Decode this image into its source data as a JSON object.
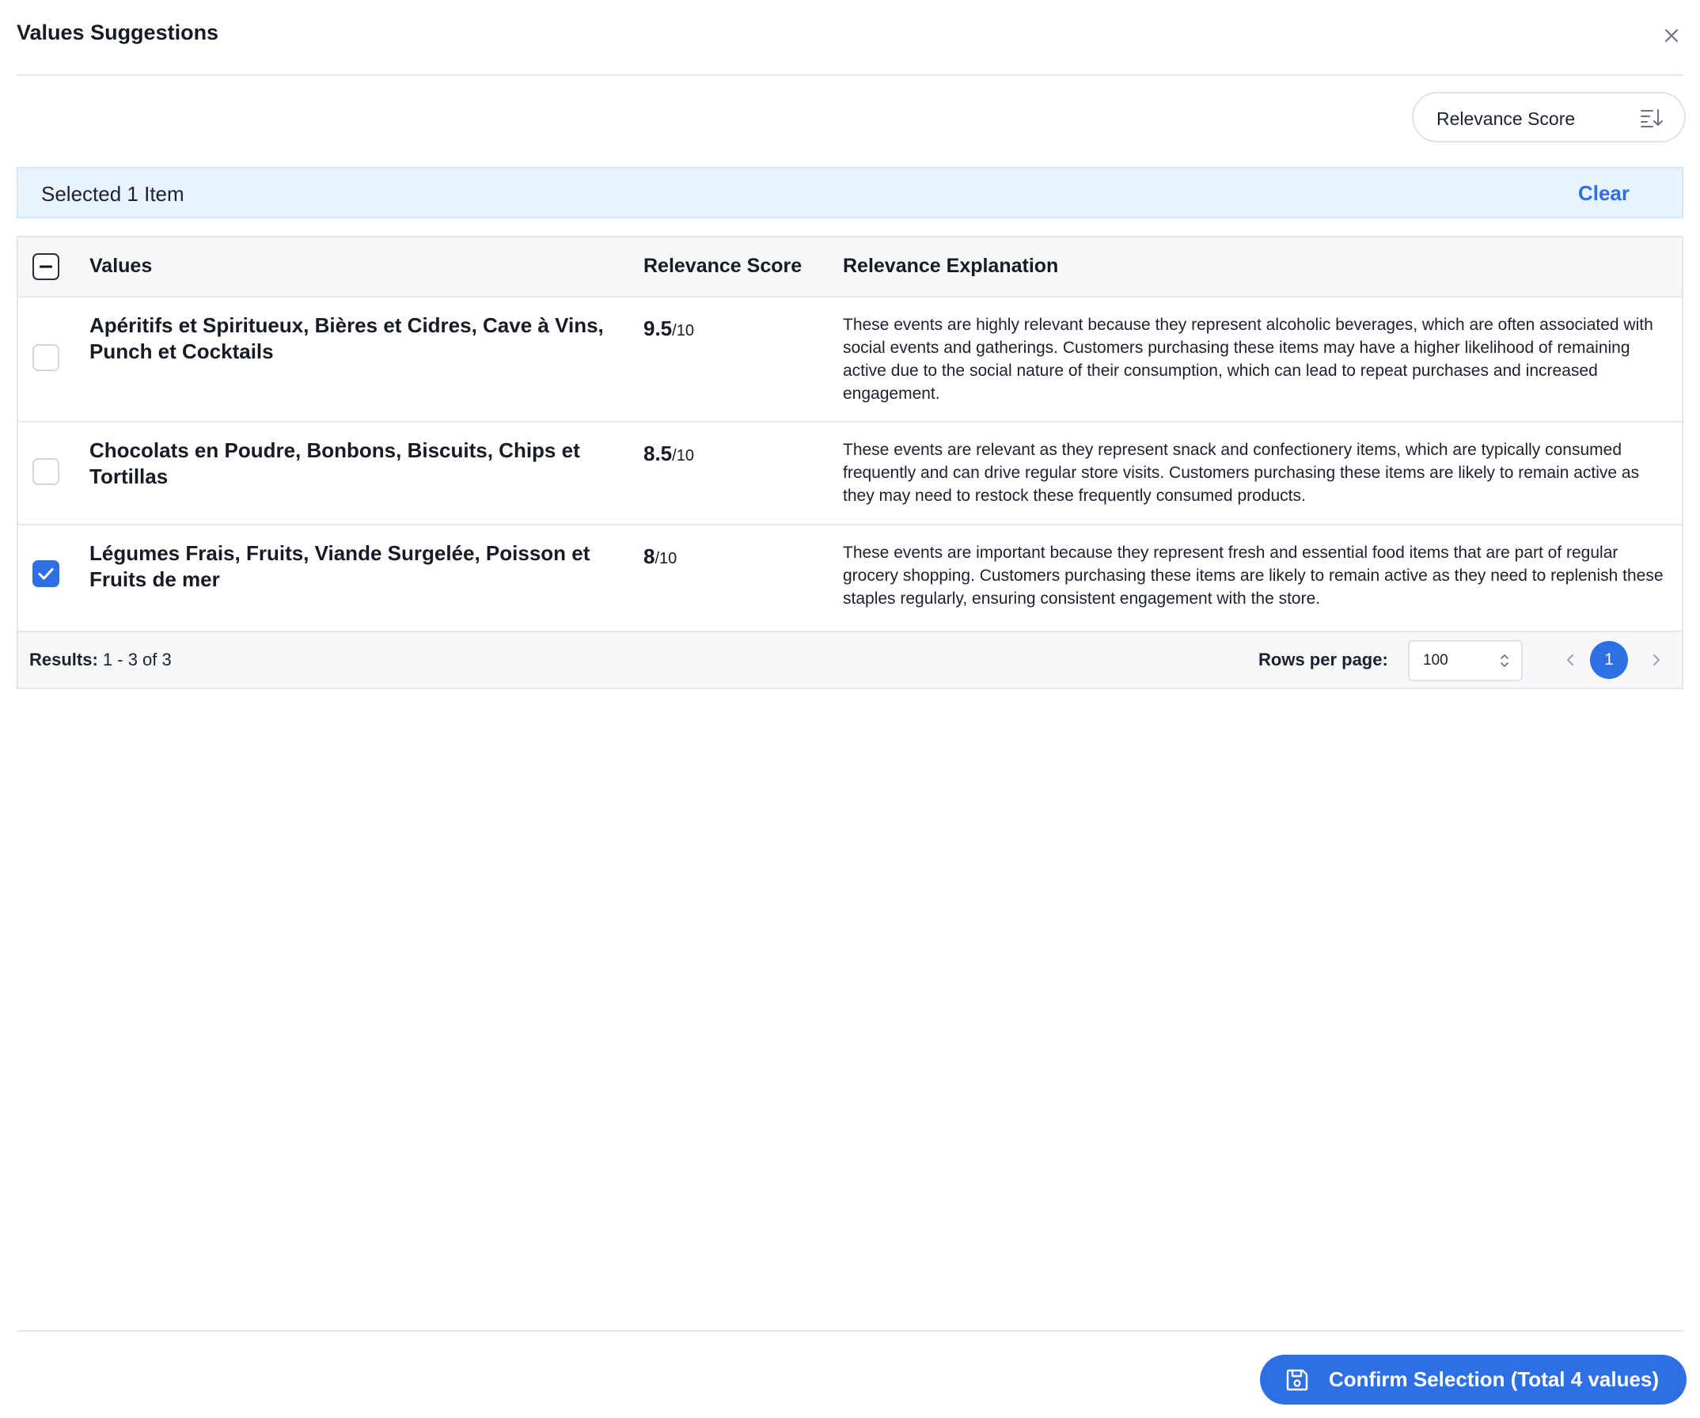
{
  "dialog": {
    "title": "Values Suggestions"
  },
  "icons": {
    "close": "close-icon",
    "sort": "sort-descending-icon",
    "save": "save-icon",
    "chevron_left": "chevron-left-icon",
    "chevron_right": "chevron-right-icon",
    "check": "check-icon",
    "indeterminate": "minus-icon"
  },
  "sort": {
    "label": "Relevance Score"
  },
  "selection": {
    "text": "Selected 1 Item",
    "clear_label": "Clear"
  },
  "table": {
    "headers": {
      "values": "Values",
      "score": "Relevance Score",
      "explanation": "Relevance Explanation"
    },
    "header_checkbox_state": "indeterminate",
    "rows": [
      {
        "checked": false,
        "values": "Apéritifs et Spiritueux, Bières et Cidres, Cave à Vins, Punch et Cocktails",
        "score": "9.5",
        "score_denominator": "/10",
        "explanation": "These events are highly relevant because they represent alcoholic beverages, which are often associated with social events and gatherings. Customers purchasing these items may have a higher likelihood of remaining active due to the social nature of their consumption, which can lead to repeat purchases and increased engagement."
      },
      {
        "checked": false,
        "values": "Chocolats en Poudre, Bonbons, Biscuits, Chips et Tortillas",
        "score": "8.5",
        "score_denominator": "/10",
        "explanation": "These events are relevant as they represent snack and confectionery items, which are typically consumed frequently and can drive regular store visits. Customers purchasing these items are likely to remain active as they may need to restock these frequently consumed products."
      },
      {
        "checked": true,
        "values": "Légumes Frais, Fruits, Viande Surgelée, Poisson et Fruits de mer",
        "score": "8",
        "score_denominator": "/10",
        "explanation": "These events are important because they represent fresh and essential food items that are part of regular grocery shopping. Customers purchasing these items are likely to remain active as they need to replenish these staples regularly, ensuring consistent engagement with the store."
      }
    ]
  },
  "pagination": {
    "results_label": "Results:",
    "results_range": "1 - 3 of 3",
    "rows_per_page_label": "Rows per page:",
    "rows_per_page_value": "100",
    "current_page": "1"
  },
  "footer": {
    "confirm_label": "Confirm Selection (Total 4 values)"
  },
  "colors": {
    "accent": "#2f6fe4",
    "banner_bg": "#e9f3fd",
    "header_bg": "#f6f7f9",
    "border": "#e3e6ea"
  }
}
